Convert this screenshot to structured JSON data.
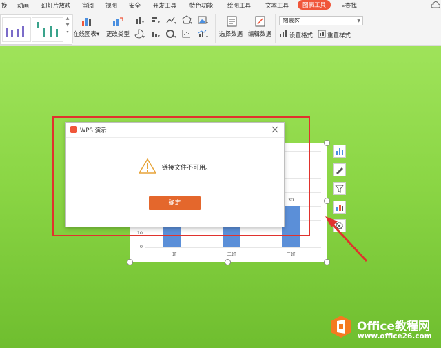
{
  "ribbon": {
    "tabs": [
      "换",
      "动画",
      "幻灯片放映",
      "审阅",
      "视图",
      "安全",
      "开发工具",
      "特色功能",
      "绘图工具",
      "文本工具",
      "图表工具"
    ],
    "search_label": "查找",
    "online_chart_label": "在线图表",
    "change_type_label": "更改类型",
    "select_data_label": "选择数据",
    "edit_data_label": "编辑数据",
    "area_select_value": "图表区",
    "format_label": "设置格式",
    "reset_style_label": "重置样式"
  },
  "chart": {
    "type": "bar",
    "categories": [
      "一班",
      "二班",
      "三班"
    ],
    "values": [
      30,
      30,
      30
    ],
    "y_ticks": [
      "0",
      "10"
    ],
    "data_label": "30",
    "bar_color": "#5b8fd8"
  },
  "dialog": {
    "title": "WPS 演示",
    "message": "链接文件不可用。",
    "ok_label": "确定",
    "button_color": "#e4672c"
  },
  "watermark": {
    "title": "Office教程网",
    "url": "www.office26.com"
  },
  "colors": {
    "accent": "#f0563a",
    "background": "#8bd645",
    "highlight": "#e0322d"
  }
}
